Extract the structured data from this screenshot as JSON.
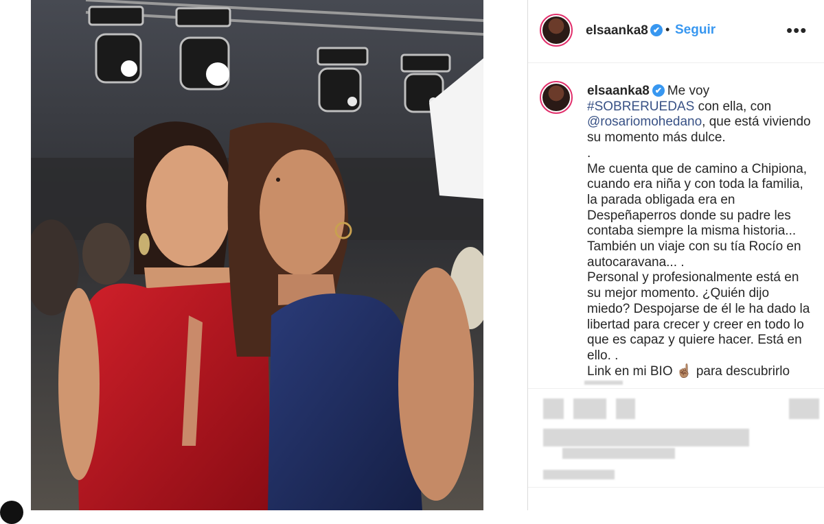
{
  "post": {
    "username": "elsaanka8",
    "verified_mark": "✔",
    "separator": "•",
    "follow_label": "Seguir",
    "more_label": "•••"
  },
  "caption": {
    "username": "elsaanka8",
    "lines": [
      "Me voy",
      "#SOBRERUEDAS",
      "con ella, con",
      "@rosariomohedano",
      ", que está viviendo su momento más dulce.",
      ".",
      "Me cuenta que de camino a Chipiona, cuando era niña y con toda la familia, la parada obligada era en Despeñaperros donde su padre les contaba siempre la misma historia... También un viaje con su tía Rocío en autocaravana... .",
      "Personal y profesionalmente está en su mejor momento. ¿Quién dijo miedo? Despojarse de él le ha dado la libertad para crecer y creer en todo lo que es capaz y quiere hacer. Está en ello. .",
      "Link en mi BIO",
      "☝🏽",
      "para descubrirlo"
    ]
  },
  "icons": {
    "verified": "verified-badge-icon",
    "more": "more-options-icon",
    "hand": "pointing-up-hand-icon"
  },
  "colors": {
    "accent": "#3897f0",
    "link": "#385185",
    "text": "#262626",
    "dress_red": "#b0141c",
    "dress_blue": "#1c2a5a"
  }
}
